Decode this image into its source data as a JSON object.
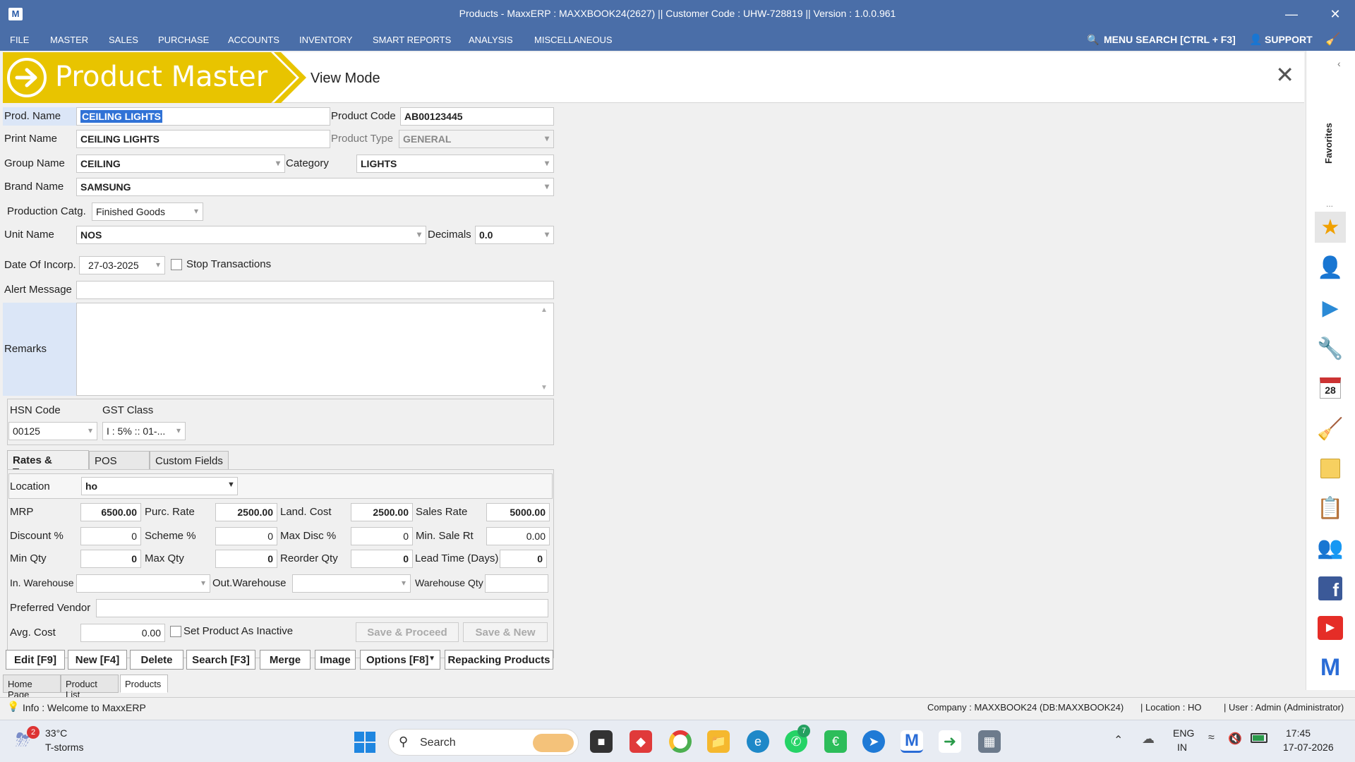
{
  "window": {
    "title": "Products - MaxxERP : MAXXBOOK24(2627)  ||  Customer Code : UHW-728819  ||  Version : 1.0.0.961",
    "logo": "M"
  },
  "menu": {
    "items": [
      "FILE",
      "MASTER",
      "SALES",
      "PURCHASE",
      "ACCOUNTS",
      "INVENTORY",
      "SMART REPORTS",
      "ANALYSIS",
      "MISCELLANEOUS"
    ],
    "search_label": "MENU SEARCH [CTRL + F3]",
    "support_label": "SUPPORT"
  },
  "header": {
    "title": "Product Master",
    "mode": "View Mode"
  },
  "form": {
    "prod_name_label": "Prod. Name",
    "prod_name": "CEILING LIGHTS",
    "product_code_label": "Product Code",
    "product_code": "AB00123445",
    "print_name_label": "Print Name",
    "print_name": "CEILING LIGHTS",
    "product_type_label": "Product Type",
    "product_type": "GENERAL",
    "group_name_label": "Group Name",
    "group_name": "CEILING",
    "category_label": "Category",
    "category": "LIGHTS",
    "brand_name_label": "Brand Name",
    "brand_name": "SAMSUNG",
    "production_catg_label": "Production Catg.",
    "production_catg": "Finished Goods",
    "unit_name_label": "Unit Name",
    "unit_name": "NOS",
    "decimals_label": "Decimals",
    "decimals": "0.0",
    "date_label": "Date Of Incorp.",
    "date": "27-03-2025",
    "stop_transactions_label": "Stop Transactions",
    "alert_message_label": "Alert Message",
    "alert_message": "",
    "remarks_label": "Remarks",
    "remarks": "",
    "hsn_code_label": "HSN Code",
    "hsn_code": "00125",
    "gst_class_label": "GST Class",
    "gst_class": "I : 5% :: 01-..."
  },
  "tabs": [
    "Rates & Taxes",
    "POS Setup",
    "Custom Fields"
  ],
  "rates": {
    "location_label": "Location",
    "location": "ho",
    "mrp_label": "MRP",
    "mrp": "6500.00",
    "purc_rate_label": "Purc. Rate",
    "purc_rate": "2500.00",
    "land_cost_label": "Land. Cost",
    "land_cost": "2500.00",
    "sales_rate_label": "Sales Rate",
    "sales_rate": "5000.00",
    "discount_label": "Discount %",
    "discount": "0",
    "scheme_label": "Scheme %",
    "scheme": "0",
    "max_disc_label": "Max Disc %",
    "max_disc": "0",
    "min_sale_label": "Min. Sale Rt",
    "min_sale": "0.00",
    "min_qty_label": "Min Qty",
    "min_qty": "0",
    "max_qty_label": "Max Qty",
    "max_qty": "0",
    "reorder_label": "Reorder Qty",
    "reorder": "0",
    "lead_time_label": "Lead Time (Days)",
    "lead_time": "0",
    "in_warehouse_label": "In. Warehouse",
    "out_warehouse_label": "Out.Warehouse",
    "warehouse_qty_label": "Warehouse Qty",
    "preferred_vendor_label": "Preferred Vendor",
    "avg_cost_label": "Avg. Cost",
    "avg_cost": "0.00",
    "inactive_label": "Set Product As Inactive",
    "save_proceed": "Save & Proceed",
    "save_new": "Save & New"
  },
  "actions": [
    "Edit [F9]",
    "New [F4]",
    "Delete",
    "Search [F3]",
    "Merge",
    "Image",
    "Options [F8]",
    "Repacking Products"
  ],
  "bottom_tabs": [
    "Home Page",
    "Product List",
    "Products"
  ],
  "dock": {
    "favorites_label": "Favorites",
    "more": "...",
    "icons": [
      "star-icon",
      "user-icon",
      "play-icon",
      "tools-icon",
      "calendar-icon",
      "broom-icon",
      "notes-icon",
      "clipboard-icon",
      "users-icon",
      "facebook-icon",
      "youtube-icon",
      "maxx-icon"
    ],
    "calendar_day": "28"
  },
  "status": {
    "info": "Info : Welcome to MaxxERP",
    "company": "Company : MAXXBOOK24 (DB:MAXXBOOK24)",
    "location": "| Location : HO",
    "user": "| User : Admin (Administrator)"
  },
  "taskbar": {
    "temp": "33°C",
    "weather": "T-storms",
    "weather_badge": "2",
    "search": "Search",
    "whatsapp_badge": "7",
    "lang": "ENG",
    "region": "IN",
    "time": "17:45",
    "date": "17-07-2026"
  },
  "colors": {
    "titlebar": "#4a6ea8",
    "banner": "#e8c400",
    "selection": "#3072d6"
  }
}
